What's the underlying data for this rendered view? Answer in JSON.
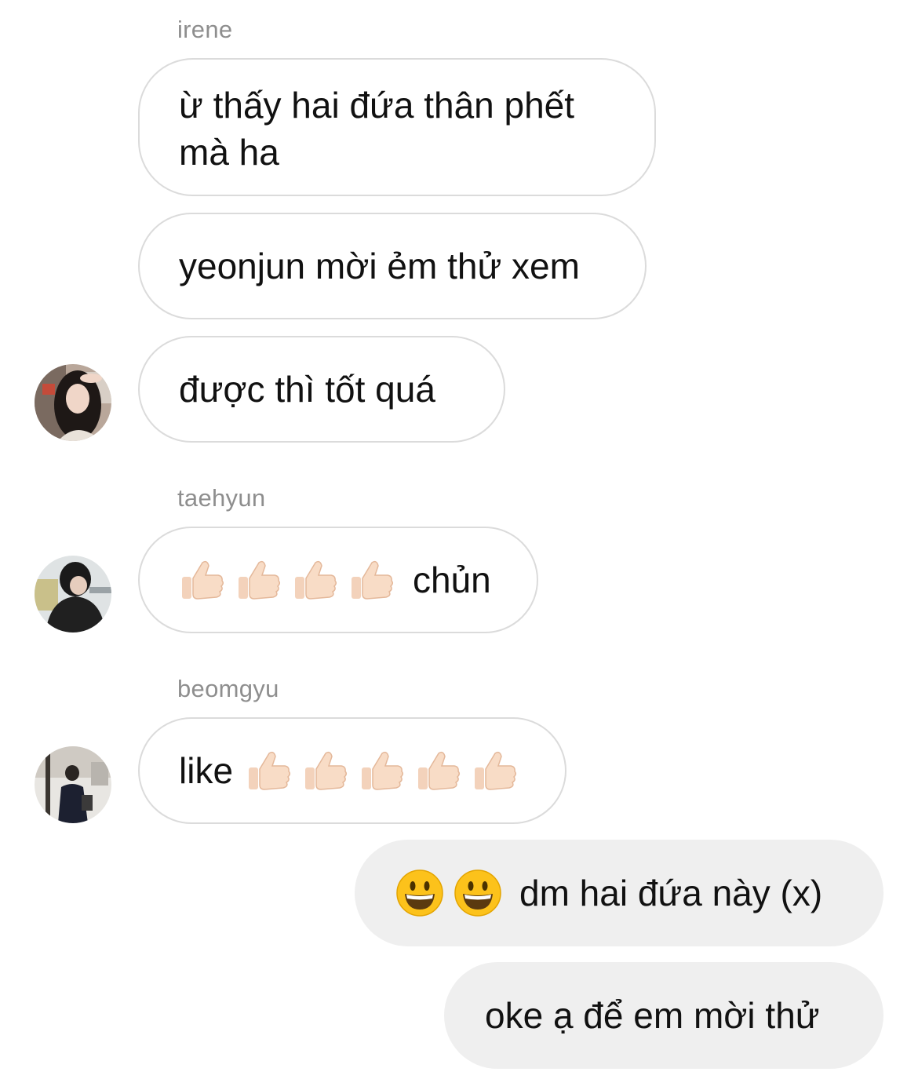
{
  "chat": {
    "messages": [
      {
        "sender": "irene",
        "text": "ừ thấy hai đứa thân phết mà ha"
      },
      {
        "text": "yeonjun mời ẻm thử xem"
      },
      {
        "text": "được thì tốt quá"
      },
      {
        "sender": "taehyun",
        "emoji": "thumbs-up",
        "emoji_count": 4,
        "text": "chủn"
      },
      {
        "sender": "beomgyu",
        "text": "like",
        "emoji": "thumbs-up",
        "emoji_count": 5
      },
      {
        "outgoing": true,
        "emoji": "grinning-face",
        "emoji_count": 2,
        "text": "dm hai đứa này (x)"
      },
      {
        "outgoing": true,
        "text": "oke ạ để em mời thử"
      }
    ]
  },
  "colors": {
    "incoming_bubble_border": "#dbdbdb",
    "outgoing_bubble_bg": "#efefef",
    "sender_name": "#8e8e8e",
    "text": "#111111"
  }
}
